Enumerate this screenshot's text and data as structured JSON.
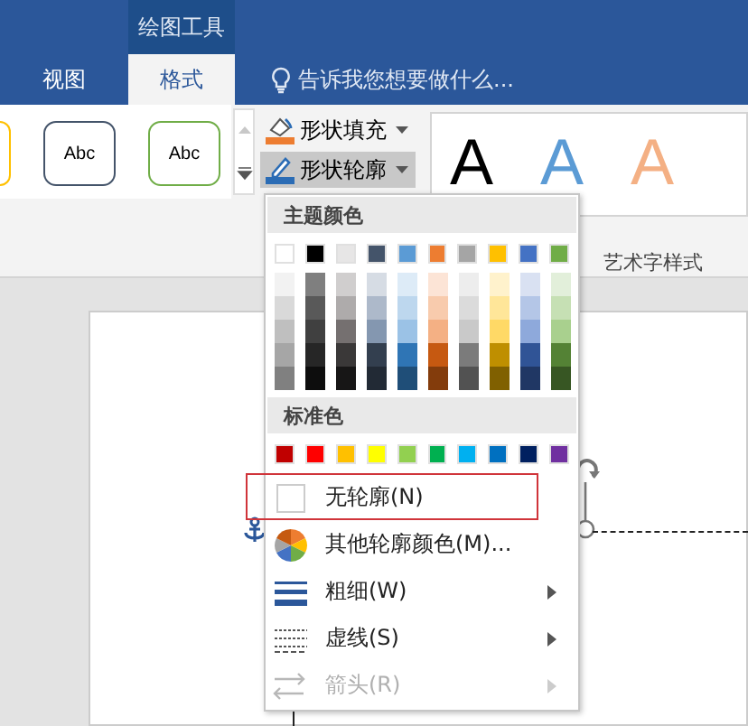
{
  "title_bar": {
    "context_group": "绘图工具"
  },
  "tabs": [
    {
      "label": "视图",
      "selected": false
    },
    {
      "label": "格式",
      "selected": true
    }
  ],
  "tell_me": {
    "placeholder": "告诉我您想要做什么..."
  },
  "shape_styles": [
    {
      "color": "#ffc000"
    },
    {
      "label": "Abc",
      "color": "#44546a"
    },
    {
      "label": "Abc",
      "color": "#70ad47"
    }
  ],
  "shape_commands": [
    {
      "label": "形状填充",
      "kind": "fill",
      "pressed": false
    },
    {
      "label": "形状轮廓",
      "kind": "outline",
      "pressed": true
    }
  ],
  "wordart": {
    "letters": [
      {
        "label": "A",
        "color": "#000000"
      },
      {
        "label": "A",
        "color": "#5b9bd5"
      },
      {
        "label": "A",
        "color": "#f4b084"
      }
    ],
    "group_label": "艺术字样式"
  },
  "outline_menu": {
    "theme_header": "主题颜色",
    "theme_colors": [
      {
        "color": "#ffffff",
        "shades": [
          {
            "color": "#f2f2f2"
          },
          {
            "color": "#d9d9d9"
          },
          {
            "color": "#bfbfbf"
          },
          {
            "color": "#a6a6a6"
          },
          {
            "color": "#808080"
          }
        ]
      },
      {
        "color": "#000000",
        "shades": [
          {
            "color": "#7f7f7f"
          },
          {
            "color": "#595959"
          },
          {
            "color": "#404040"
          },
          {
            "color": "#262626"
          },
          {
            "color": "#0d0d0d"
          }
        ]
      },
      {
        "color": "#e7e6e6",
        "shades": [
          {
            "color": "#d0cece"
          },
          {
            "color": "#aeabab"
          },
          {
            "color": "#757070"
          },
          {
            "color": "#3a3838"
          },
          {
            "color": "#171616"
          }
        ]
      },
      {
        "color": "#44546a",
        "shades": [
          {
            "color": "#d6dce4"
          },
          {
            "color": "#adb9ca"
          },
          {
            "color": "#8497b0"
          },
          {
            "color": "#333f4f"
          },
          {
            "color": "#222a35"
          }
        ]
      },
      {
        "color": "#5b9bd5",
        "shades": [
          {
            "color": "#ddebf7"
          },
          {
            "color": "#bdd7ee"
          },
          {
            "color": "#9bc2e6"
          },
          {
            "color": "#2f75b5"
          },
          {
            "color": "#1f4e78"
          }
        ]
      },
      {
        "color": "#ed7d31",
        "shades": [
          {
            "color": "#fce4d6"
          },
          {
            "color": "#f8cbad"
          },
          {
            "color": "#f4b084"
          },
          {
            "color": "#c65911"
          },
          {
            "color": "#833c0c"
          }
        ]
      },
      {
        "color": "#a5a5a5",
        "shades": [
          {
            "color": "#ededed"
          },
          {
            "color": "#dbdbdb"
          },
          {
            "color": "#c9c9c9"
          },
          {
            "color": "#7b7b7b"
          },
          {
            "color": "#525252"
          }
        ]
      },
      {
        "color": "#ffc000",
        "shades": [
          {
            "color": "#fff2cc"
          },
          {
            "color": "#ffe699"
          },
          {
            "color": "#ffd966"
          },
          {
            "color": "#bf8f00"
          },
          {
            "color": "#806000"
          }
        ]
      },
      {
        "color": "#4472c4",
        "shades": [
          {
            "color": "#d9e1f2"
          },
          {
            "color": "#b4c6e7"
          },
          {
            "color": "#8ea9db"
          },
          {
            "color": "#305496"
          },
          {
            "color": "#203764"
          }
        ]
      },
      {
        "color": "#70ad47",
        "shades": [
          {
            "color": "#e2efda"
          },
          {
            "color": "#c6e0b4"
          },
          {
            "color": "#a9d08e"
          },
          {
            "color": "#548235"
          },
          {
            "color": "#375623"
          }
        ]
      }
    ],
    "standard_header": "标准色",
    "standard_colors": [
      {
        "color": "#c00000"
      },
      {
        "color": "#ff0000"
      },
      {
        "color": "#ffc000"
      },
      {
        "color": "#ffff00"
      },
      {
        "color": "#92d050"
      },
      {
        "color": "#00b050"
      },
      {
        "color": "#00b0f0"
      },
      {
        "color": "#0070c0"
      },
      {
        "color": "#002060"
      },
      {
        "color": "#7030a0"
      }
    ],
    "items": [
      {
        "kind": "no-outline",
        "label": "无轮廓(N)",
        "submenu": false,
        "disabled": false,
        "highlighted": true
      },
      {
        "kind": "more-colors",
        "label": "其他轮廓颜色(M)...",
        "submenu": false,
        "disabled": false,
        "highlighted": false
      },
      {
        "kind": "weight",
        "label": "粗细(W)",
        "submenu": true,
        "disabled": false,
        "highlighted": false
      },
      {
        "kind": "dashes",
        "label": "虚线(S)",
        "submenu": true,
        "disabled": false,
        "highlighted": false
      },
      {
        "kind": "arrows",
        "label": "箭头(R)",
        "submenu": true,
        "disabled": true,
        "highlighted": false
      }
    ]
  }
}
